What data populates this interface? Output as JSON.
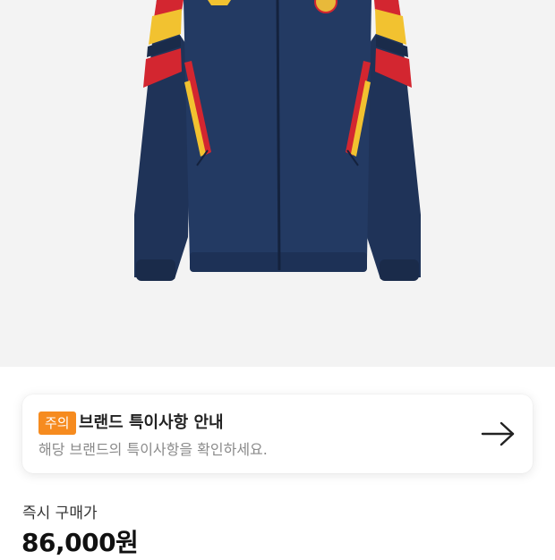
{
  "product": {
    "image_alt": "navy track jacket with red and yellow stripes"
  },
  "notice": {
    "badge": "주의",
    "title": "브랜드 특이사항 안내",
    "description": "해당 브랜드의 특이사항을 확인하세요.",
    "arrow_icon": "arrow-right-icon",
    "badge_color": "#f68b1f"
  },
  "price": {
    "label": "즉시 구매가",
    "value": "86,000원"
  }
}
